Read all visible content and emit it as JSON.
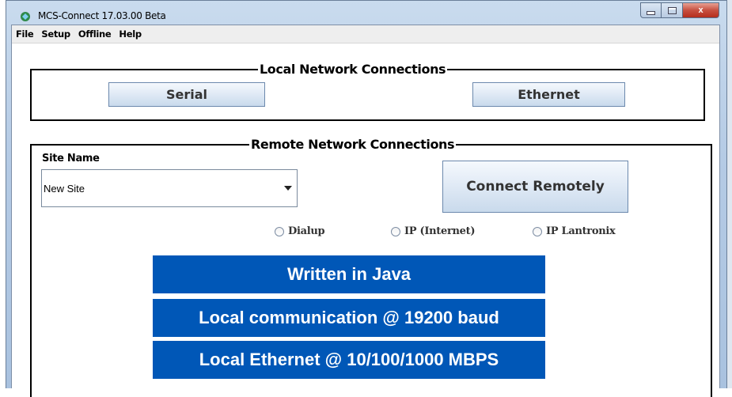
{
  "window": {
    "title": "MCS-Connect 17.03.00 Beta",
    "min_icon": "minimize-icon",
    "max_icon": "maximize-icon",
    "close_icon": "close-icon",
    "close_glyph": "x"
  },
  "menu": [
    "File",
    "Setup",
    "Offline",
    "Help"
  ],
  "local": {
    "legend": "Local Network Connections",
    "serial_label": "Serial",
    "ethernet_label": "Ethernet"
  },
  "remote": {
    "legend": "Remote Network Connections",
    "site_label": "Site Name",
    "site_value": "New Site",
    "connect_label": "Connect Remotely",
    "radios": [
      "Dialup",
      "IP (Internet)",
      "IP Lantronix"
    ]
  },
  "banners": [
    "Written in Java",
    "Local communication @ 19200 baud",
    "Local Ethernet @ 10/100/1000 MBPS"
  ],
  "colors": {
    "banner_bg": "#0057b7",
    "accent_close": "#c75040"
  }
}
